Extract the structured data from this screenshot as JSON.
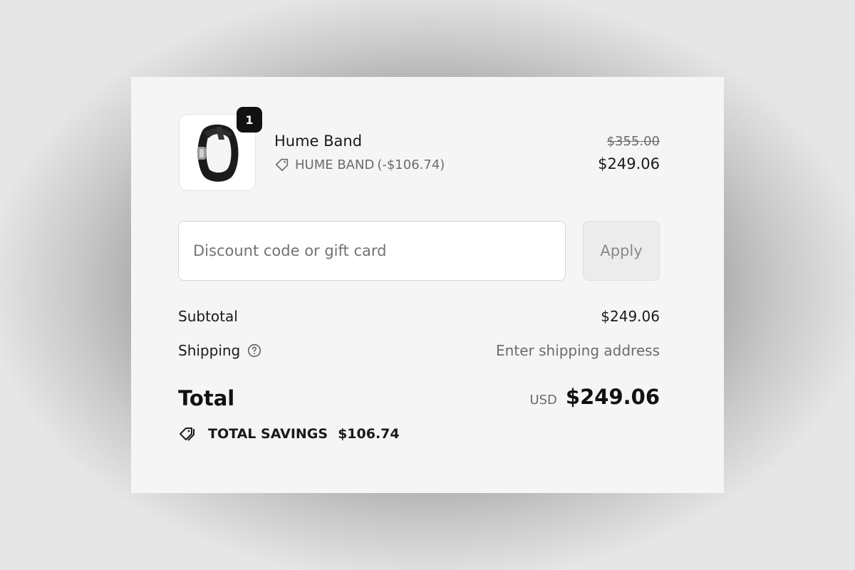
{
  "product": {
    "name": "Hume Band",
    "quantity": "1",
    "discount_label": "HUME BAND",
    "discount_amount": "(-$106.74)",
    "original_price": "$355.00",
    "current_price": "$249.06",
    "thumbnail_icon": "watch-band-image"
  },
  "discount": {
    "placeholder": "Discount code or gift card",
    "apply_label": "Apply"
  },
  "summary": {
    "subtotal_label": "Subtotal",
    "subtotal_value": "$249.06",
    "shipping_label": "Shipping",
    "shipping_value": "Enter shipping address"
  },
  "total": {
    "label": "Total",
    "currency": "USD",
    "amount": "$249.06"
  },
  "savings": {
    "label": "TOTAL SAVINGS",
    "amount": "$106.74"
  },
  "colors": {
    "panel_bg": "#f5f5f5",
    "badge_bg": "#111111",
    "muted_text": "#6b6b6b"
  }
}
